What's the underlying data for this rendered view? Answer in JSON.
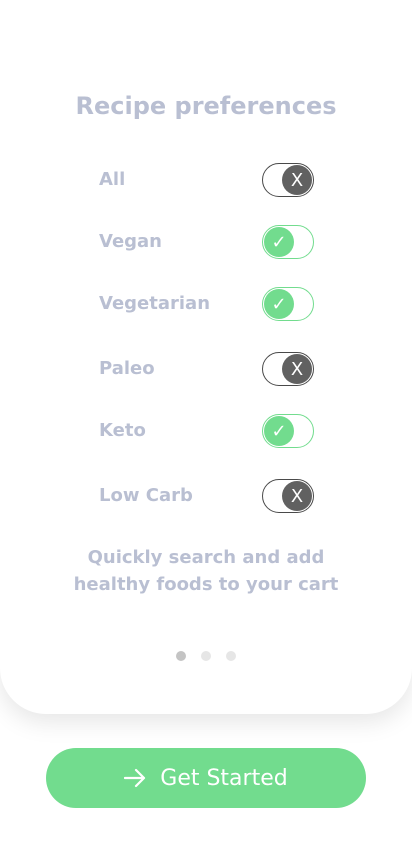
{
  "header": {
    "title": "Recipe preferences"
  },
  "preferences": [
    {
      "label": "All",
      "enabled": false,
      "glyph": "X"
    },
    {
      "label": "Vegan",
      "enabled": true,
      "glyph": "✓"
    },
    {
      "label": "Vegetarian",
      "enabled": true,
      "glyph": "✓"
    },
    {
      "label": "Paleo",
      "enabled": false,
      "glyph": "X"
    },
    {
      "label": "Keto",
      "enabled": true,
      "glyph": "✓"
    },
    {
      "label": "Low Carb",
      "enabled": false,
      "glyph": "X"
    }
  ],
  "tagline": {
    "line1": "Quickly search and add",
    "line2": "healthy foods to your cart"
  },
  "pager": {
    "count": 3,
    "active": 0
  },
  "cta": {
    "label": "Get Started",
    "icon": "arrow-right-icon"
  },
  "colors": {
    "accent": "#72dc8e",
    "text_muted": "#b9bfd2",
    "toggle_off": "#616161"
  }
}
